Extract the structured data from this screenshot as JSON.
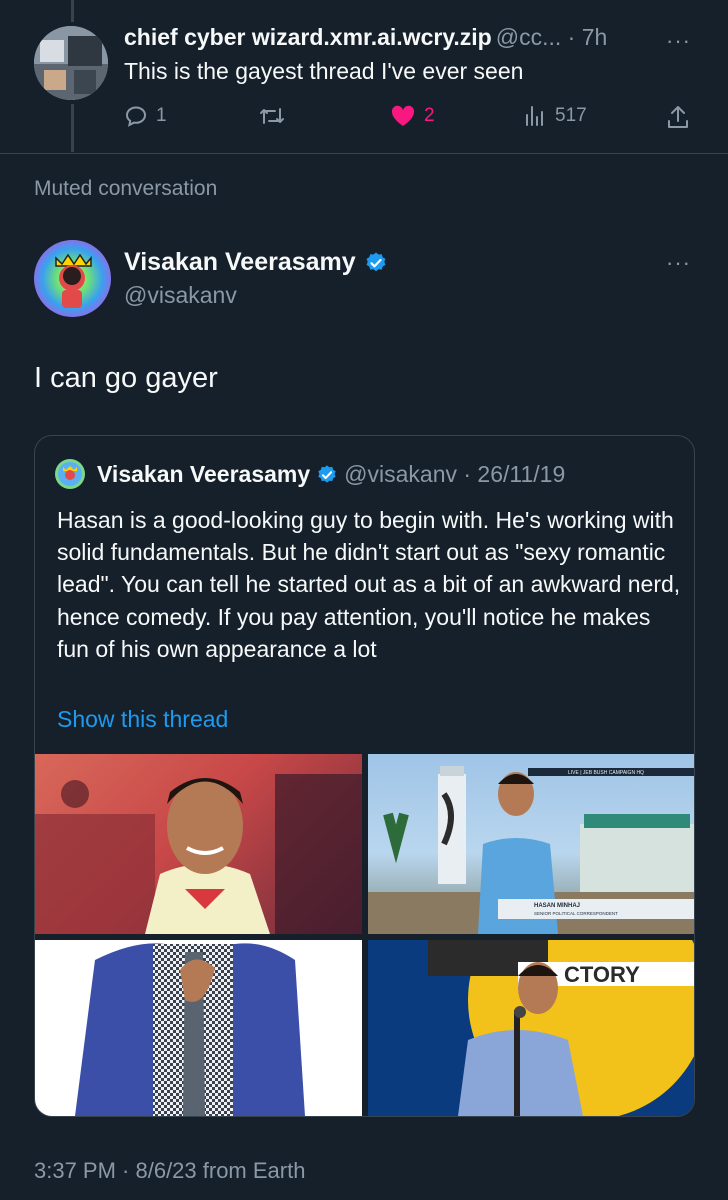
{
  "top_tweet": {
    "display_name": "chief cyber wizard.xmr.ai.wcry.zip",
    "handle_time": "@cc... · 7h",
    "text": "This is the gayest thread I've ever seen",
    "replies": "1",
    "likes": "2",
    "views": "517",
    "liked": true
  },
  "muted_label": "Muted conversation",
  "main_tweet": {
    "display_name": "Visakan Veerasamy",
    "handle": "@visakanv",
    "text": "I can go gayer",
    "timestamp": "3:37 PM · 8/6/23 from Earth"
  },
  "quoted_tweet": {
    "display_name": "Visakan Veerasamy",
    "handle_date": "@visakanv · 26/11/19",
    "text": "Hasan is a good-looking guy to begin with. He's working with solid fundamentals. But he didn't start out as \"sexy romantic lead\".  You can tell he started out as a bit of an awkward nerd, hence comedy. If you pay attention, you'll notice he makes fun of his own appearance a lot",
    "show_thread": "Show this thread",
    "image_texts": {
      "news_banner": "LIVE | JEB BUSH CAMPAIGN HQ",
      "lower_third_name": "HASAN MINHAJ",
      "lower_third_title": "SENIOR POLITICAL CORRESPONDENT",
      "sign_text": "CTORY"
    }
  },
  "colors": {
    "background": "#15202b",
    "accent": "#1d9bf0",
    "like": "#f91880",
    "muted_text": "#8b98a5",
    "border": "#38444d"
  }
}
